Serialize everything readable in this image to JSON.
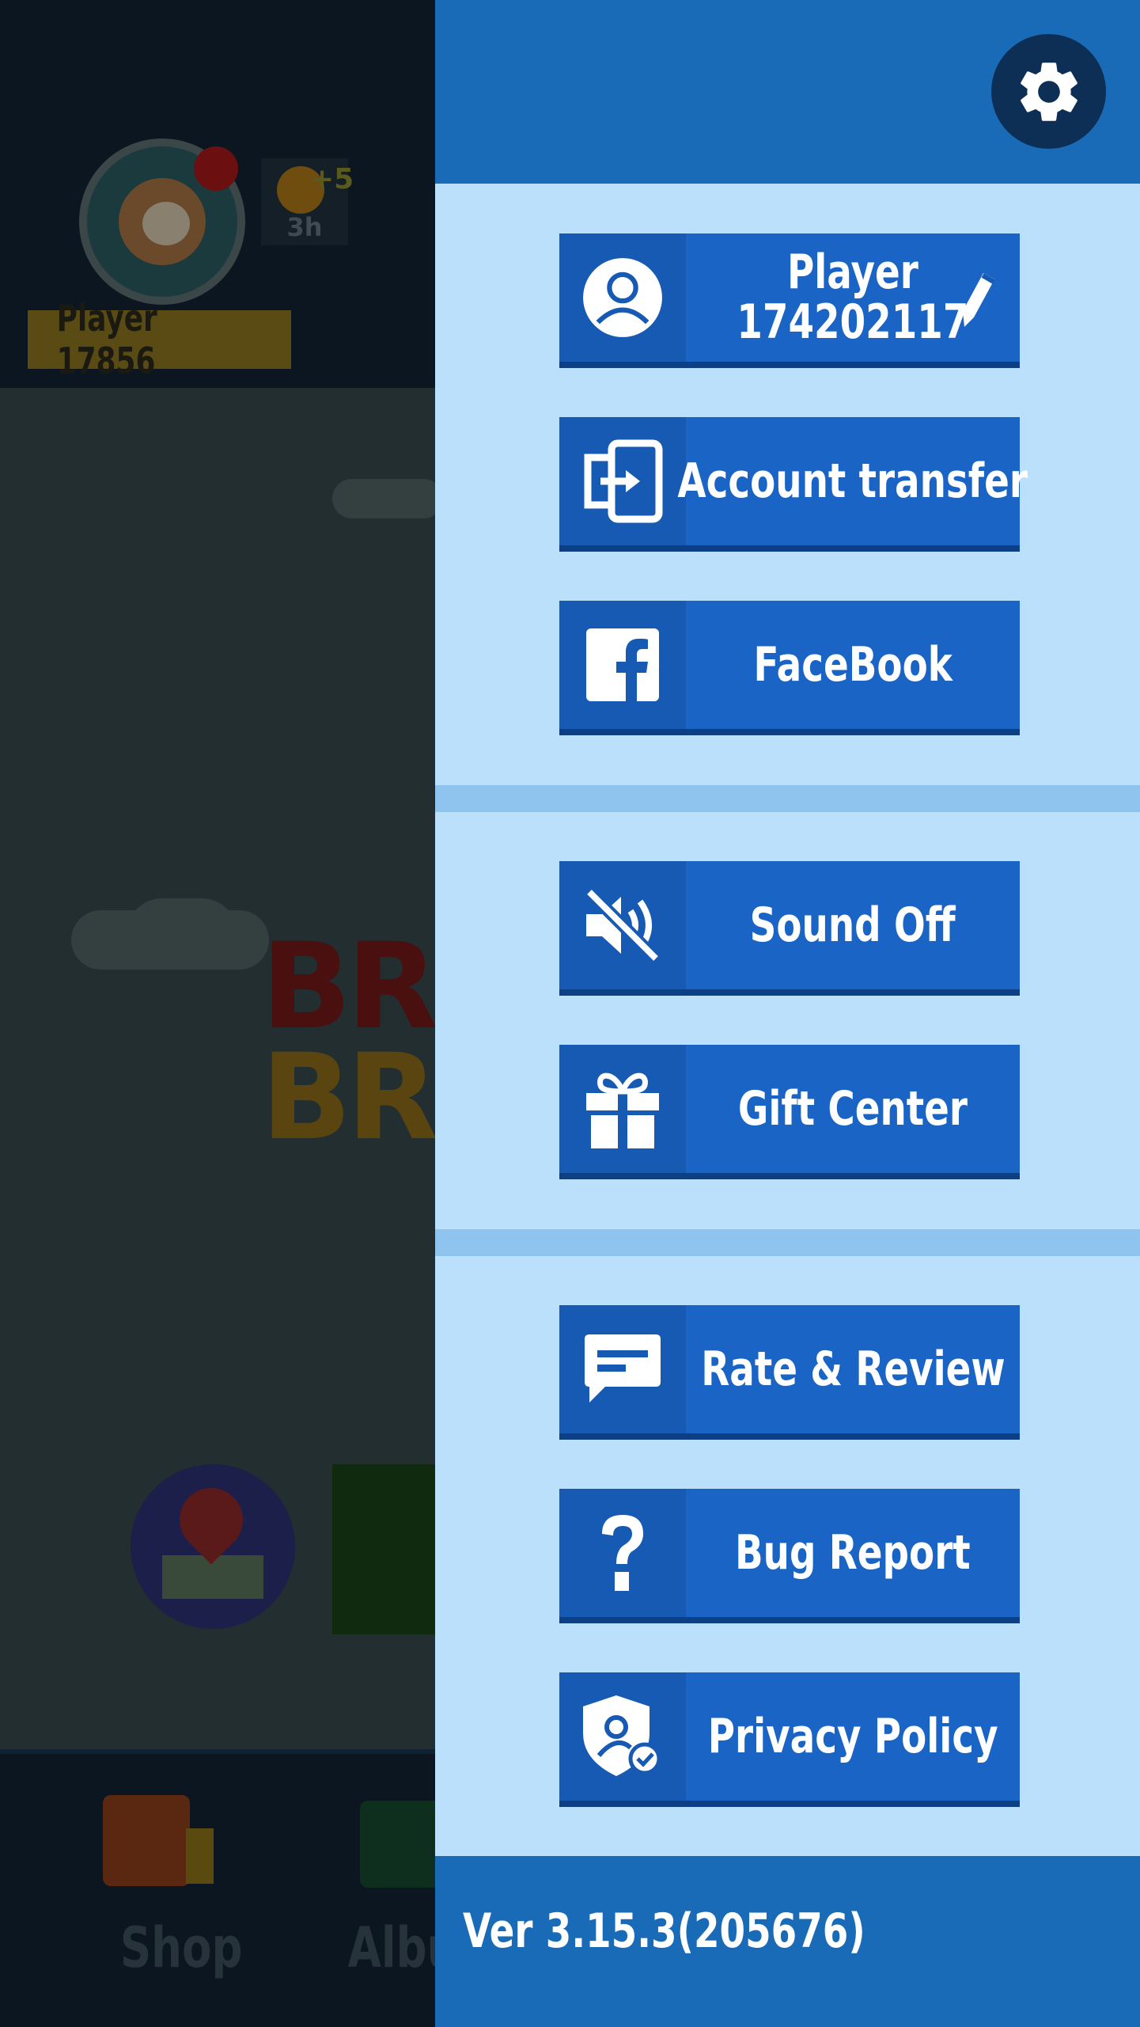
{
  "background": {
    "player_name": "Player 17856",
    "coin_plus": "+5",
    "coin_timer": "3h",
    "logo_line1": "BR",
    "logo_line2": "BR",
    "tabs": [
      {
        "label": "Shop",
        "icon": "shop-bag-icon"
      },
      {
        "label": "Albu",
        "icon": "album-icon"
      }
    ]
  },
  "drawer": {
    "header": {
      "settings_icon": "gear-icon"
    },
    "sections": [
      {
        "items": [
          {
            "id": "player",
            "line1": "Player",
            "line2": "174202117",
            "icon": "user-profile-icon",
            "edit_icon": "pencil-icon"
          },
          {
            "id": "account_transfer",
            "label": "Account transfer",
            "icon": "account-transfer-icon"
          },
          {
            "id": "facebook",
            "label": "FaceBook",
            "icon": "facebook-icon"
          }
        ]
      },
      {
        "items": [
          {
            "id": "sound",
            "label": "Sound Off",
            "icon": "sound-off-icon"
          },
          {
            "id": "gift",
            "label": "Gift Center",
            "icon": "gift-icon"
          }
        ]
      },
      {
        "items": [
          {
            "id": "rate",
            "label": "Rate & Review",
            "icon": "chat-bubble-icon"
          },
          {
            "id": "bug",
            "label": "Bug Report",
            "icon": "question-mark-icon"
          },
          {
            "id": "privacy",
            "label": "Privacy Policy",
            "icon": "privacy-shield-icon"
          }
        ]
      }
    ],
    "footer": {
      "version": "Ver 3.15.3(205676)"
    }
  },
  "colors": {
    "drawer_bg": "#bbe0fb",
    "header_bg": "#1a6bb7",
    "button_bg": "#1a64c6",
    "button_icon_bg": "#165ab4",
    "separator": "#8ec4ee"
  }
}
